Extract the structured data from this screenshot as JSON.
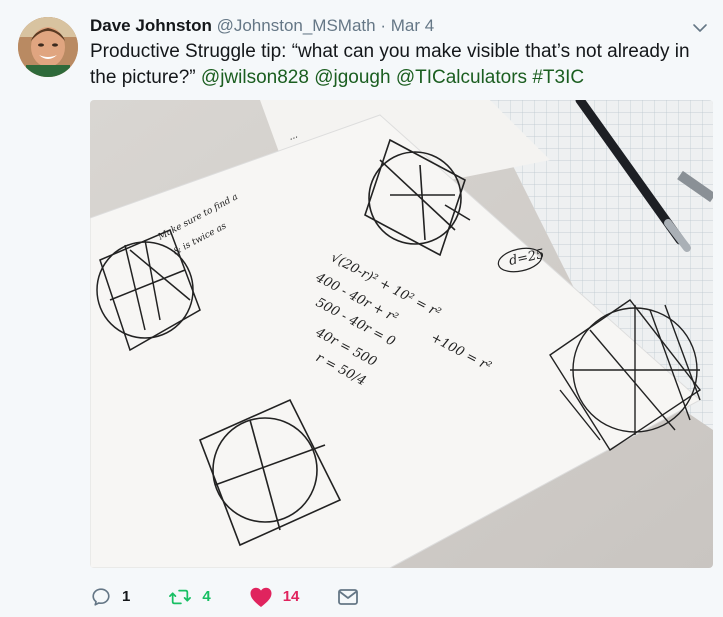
{
  "tweet": {
    "author_name": "Dave Johnston",
    "author_handle": "@Johnston_MSMath",
    "separator": " · ",
    "date": "Mar 4",
    "text_prefix": "Productive Struggle tip: “what can you make visible that’s not already in the picture?” ",
    "mentions": [
      "@jwilson828",
      "@jgough",
      "@TICalculators",
      "#T3IC"
    ]
  },
  "actions": {
    "replies": "1",
    "retweets": "4",
    "likes": "14"
  },
  "icons": {
    "reply": "reply-icon",
    "retweet": "retweet-icon",
    "like": "heart-icon",
    "dm": "envelope-icon",
    "menu": "chevron-down-icon"
  },
  "colors": {
    "link": "#1b5e20",
    "retweet": "#17bf63",
    "like": "#e0245e",
    "muted": "#657786"
  },
  "photo_math": {
    "expr1": "√(20-r)² + 10² = r²",
    "line2": "400 - 40r + r²",
    "line2b": "+100 = r²",
    "line3": "500 - 40r = 0",
    "line4": "40r = 500",
    "line5": "r = 50/4",
    "d_label": "d=25",
    "note1": "Make sure to find a",
    "note2": "& is twice as",
    "note3": "..."
  }
}
